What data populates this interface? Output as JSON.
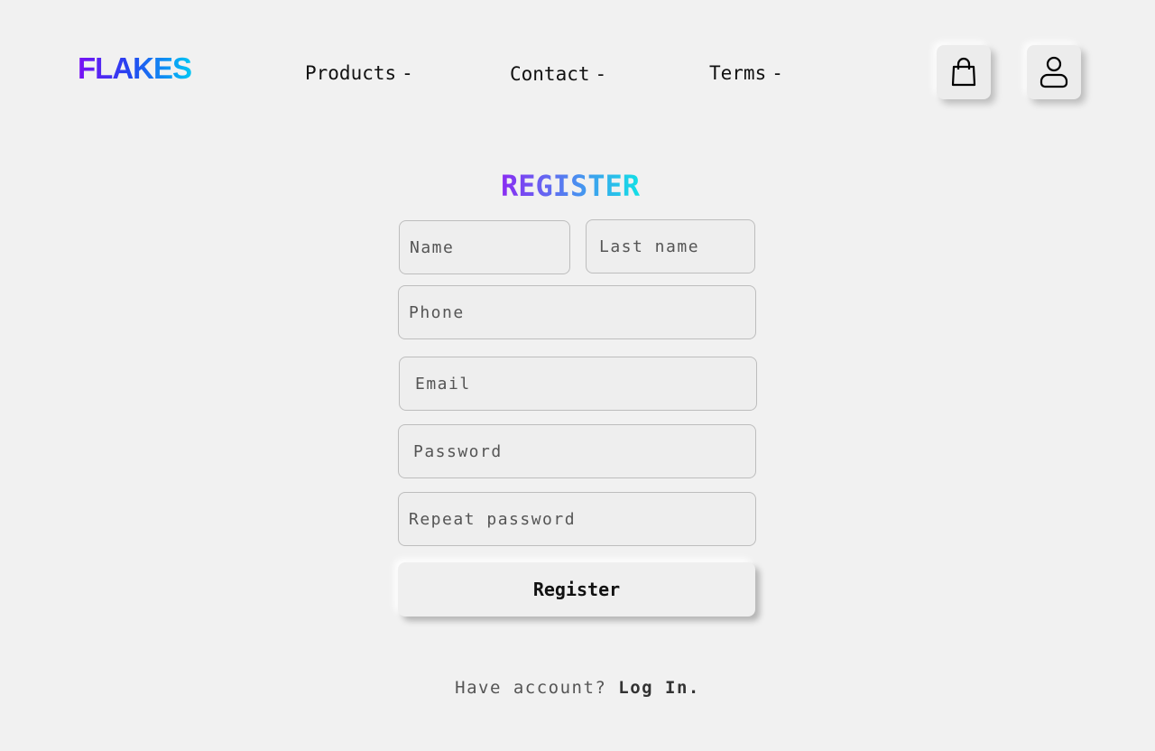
{
  "brand": {
    "logo_text": "FLAKES"
  },
  "nav": {
    "items": [
      {
        "label": "Products",
        "suffix": "-"
      },
      {
        "label": "Contact",
        "suffix": "-"
      },
      {
        "label": "Terms",
        "suffix": "-"
      }
    ],
    "cart_icon": "shopping-bag-icon",
    "user_icon": "user-icon"
  },
  "form": {
    "title": "REGISTER",
    "fields": {
      "name": {
        "placeholder": "Name",
        "value": ""
      },
      "last_name": {
        "placeholder": "Last name",
        "value": ""
      },
      "phone": {
        "placeholder": "Phone",
        "value": ""
      },
      "email": {
        "placeholder": "Email",
        "value": ""
      },
      "password": {
        "placeholder": "Password",
        "value": ""
      },
      "repeat_password": {
        "placeholder": "Repeat password",
        "value": ""
      }
    },
    "submit_label": "Register"
  },
  "footer": {
    "prompt": "Have account?",
    "login_label": "Log In."
  },
  "colors": {
    "background": "#f1f1f1",
    "logo_gradient_start": "#7a10f5",
    "logo_gradient_end": "#00c6f5",
    "title_gradient_start": "#8a2cf2",
    "title_gradient_end": "#12e0e6"
  }
}
